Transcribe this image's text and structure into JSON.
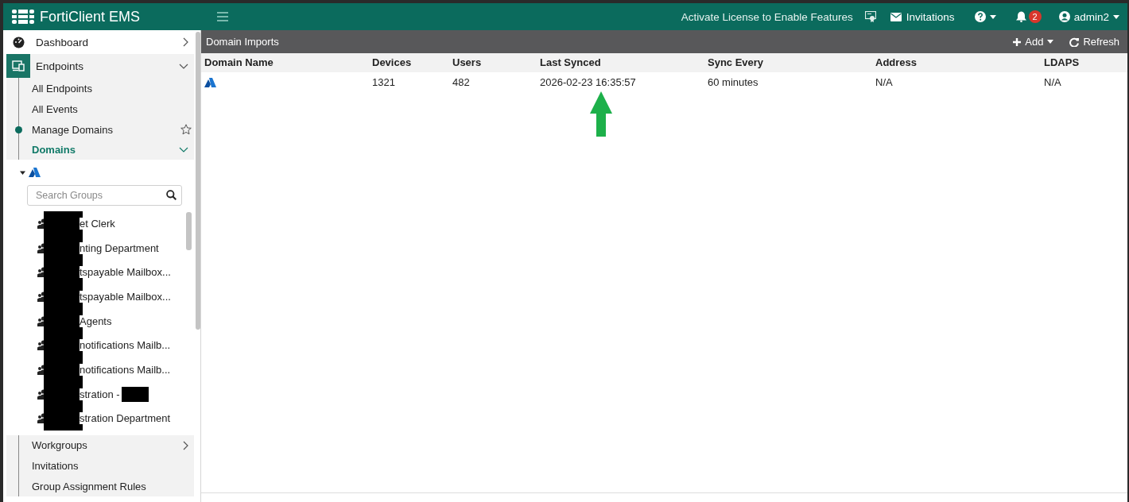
{
  "header": {
    "title": "FortiClient EMS",
    "license_notice": "Activate License to Enable Features",
    "invitations": "Invitations",
    "notification_count": "2",
    "user": "admin2"
  },
  "sidebar": {
    "items": [
      {
        "kind": "section",
        "label": "Dashboard",
        "expanded": false,
        "selected": false
      },
      {
        "kind": "section",
        "label": "Endpoints",
        "expanded": true,
        "selected": true
      },
      {
        "kind": "link",
        "label": "All Endpoints",
        "current": false
      },
      {
        "kind": "link",
        "label": "All Events",
        "current": false
      },
      {
        "kind": "link",
        "label": "Manage Domains",
        "current": true,
        "starred": false
      },
      {
        "kind": "group",
        "label": "Domains",
        "expanded": true,
        "selected": true
      },
      {
        "kind": "domain_tree",
        "expanded": true,
        "search": {
          "placeholder": "Search Groups"
        },
        "groups": [
          {
            "label": "et Clerk",
            "redacted_end": false
          },
          {
            "label": "nting Department",
            "redacted_end": false
          },
          {
            "label": "tspayable Mailbox...",
            "redacted_end": false
          },
          {
            "label": "tspayable Mailbox...",
            "redacted_end": false
          },
          {
            "label": "Agents",
            "redacted_end": false
          },
          {
            "label": "notifications Mailb...",
            "redacted_end": false
          },
          {
            "label": "notifications Mailb...",
            "redacted_end": false
          },
          {
            "label": "stration -",
            "redacted_end": true
          },
          {
            "label": "stration Department",
            "redacted_end": false
          }
        ]
      },
      {
        "kind": "group",
        "label": "Workgroups",
        "expanded": false,
        "selected": false
      },
      {
        "kind": "link",
        "label": "Invitations",
        "current": false
      },
      {
        "kind": "link",
        "label": "Group Assignment Rules",
        "current": false
      }
    ]
  },
  "main": {
    "title": "Domain Imports",
    "actions": [
      {
        "kind": "add",
        "label": "Add"
      },
      {
        "kind": "refresh",
        "label": "Refresh"
      }
    ],
    "table": {
      "columns": [
        "Domain Name",
        "Devices",
        "Users",
        "Last Synced",
        "Sync Every",
        "Address",
        "LDAPS"
      ],
      "rows": [
        {
          "cells": [
            "",
            "1321",
            "482",
            "2026-02-23 16:35:57",
            "60 minutes",
            "N/A",
            "N/A"
          ]
        }
      ]
    },
    "annotations": [
      {
        "kind": "arrow_up"
      }
    ]
  }
}
